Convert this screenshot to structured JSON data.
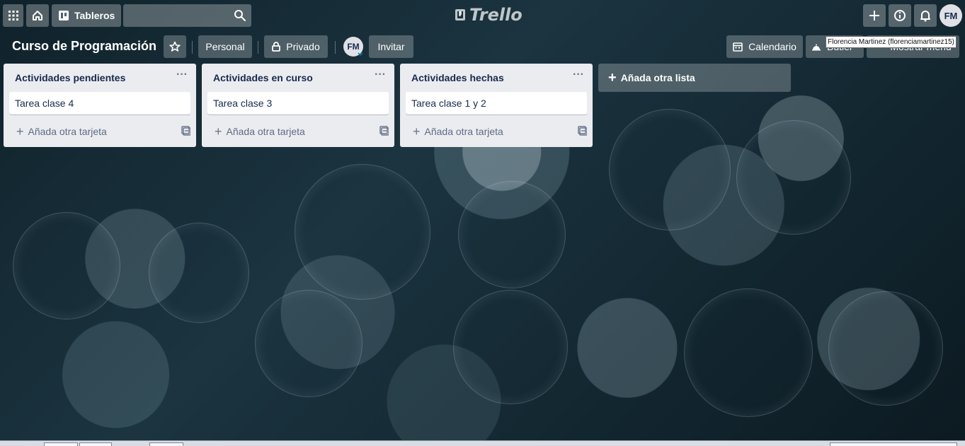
{
  "topbar": {
    "boards_label": "Tableros",
    "logo_text": "Trello",
    "avatar_initials": "FM",
    "tooltip_text": "Florencia Martinez (florenciamartinez15)"
  },
  "board": {
    "title": "Curso de Programación",
    "personal_label": "Personal",
    "private_label": "Privado",
    "member_initials": "FM",
    "invite_label": "Invitar",
    "calendar_label": "Calendario",
    "butler_label": "Butler",
    "menu_label": "Mostrar menú"
  },
  "lists": [
    {
      "title": "Actividades pendientes",
      "card": "Tarea clase 4",
      "add_card": "Añada otra tarjeta"
    },
    {
      "title": "Actividades en curso",
      "card": "Tarea clase 3",
      "add_card": "Añada otra tarjeta"
    },
    {
      "title": "Actividades hechas",
      "card": "Tarea clase 1 y 2",
      "add_card": "Añada otra tarjeta"
    }
  ],
  "add_list_label": "Añada otra lista",
  "colors": {
    "header_overlay": "rgba(255,255,255,0.28)",
    "list_background": "#ebecf0",
    "card_background": "#ffffff",
    "text_primary": "#172b4d",
    "text_secondary": "#5e6c84"
  }
}
